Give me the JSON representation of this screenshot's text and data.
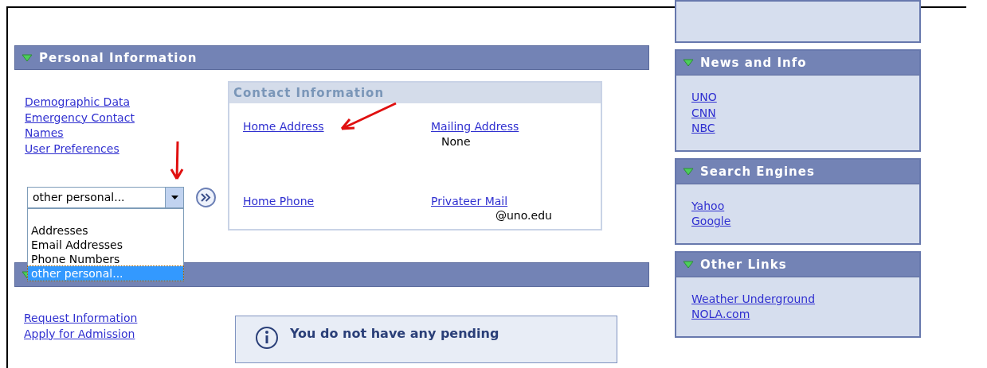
{
  "personal_section": {
    "title": "Personal Information",
    "expanded": true,
    "links": [
      "Demographic Data",
      "Emergency Contact",
      "Names",
      "User Preferences"
    ],
    "dropdown": {
      "value": "other personal...",
      "expanded": true,
      "options": [
        {
          "label": "Addresses",
          "selected": false
        },
        {
          "label": "Email Addresses",
          "selected": false
        },
        {
          "label": "Phone Numbers",
          "selected": false
        },
        {
          "label": "other personal...",
          "selected": true
        }
      ]
    },
    "contact_box": {
      "title": "Contact Information",
      "items": [
        {
          "label": "Home Address"
        },
        {
          "label": "Mailing Address",
          "value": "None"
        },
        {
          "label": "Home Phone"
        },
        {
          "label": "Privateer Mail",
          "value": "@uno.edu"
        }
      ]
    }
  },
  "second_section": {
    "expanded": true,
    "links": [
      "Request Information",
      "Apply for Admission"
    ],
    "notice": "You do not have any pending"
  },
  "sidebar": [
    {
      "title": "News and Info",
      "expanded": true,
      "links": [
        "UNO",
        "CNN",
        "NBC"
      ]
    },
    {
      "title": "Search Engines",
      "expanded": true,
      "links": [
        "Yahoo",
        "Google"
      ]
    },
    {
      "title": "Other Links",
      "expanded": true,
      "links": [
        "Weather Underground",
        "NOLA.com"
      ]
    }
  ]
}
